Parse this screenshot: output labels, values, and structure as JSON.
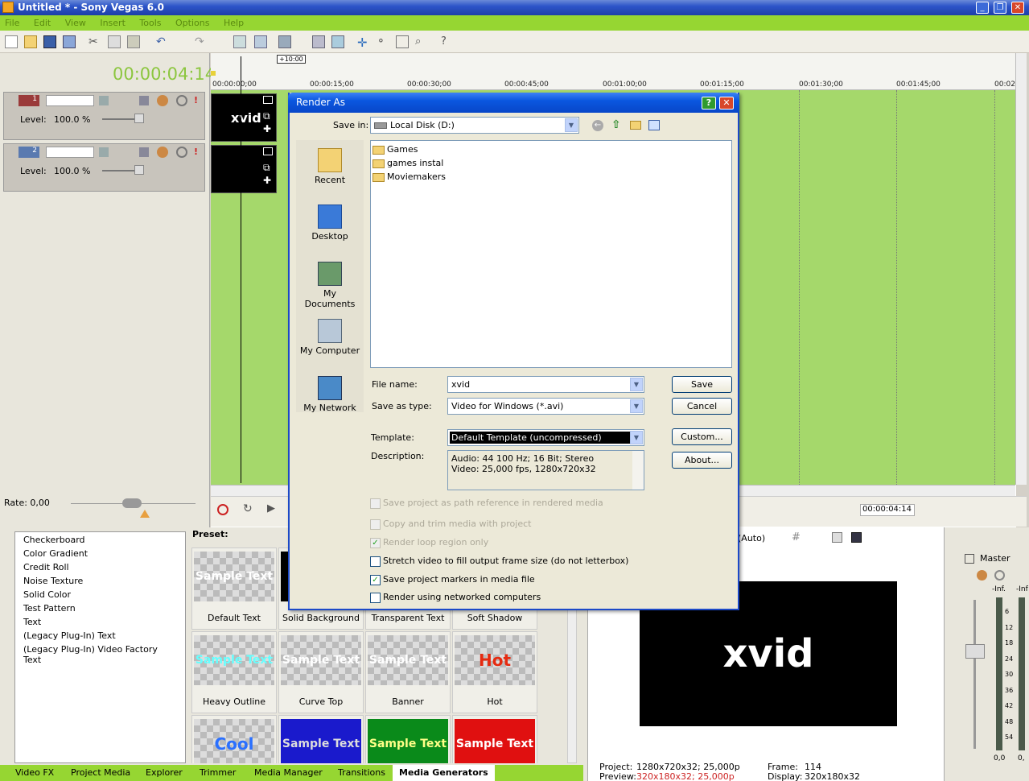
{
  "window": {
    "title": "Untitled * - Sony Vegas 6.0"
  },
  "menu": [
    "File",
    "Edit",
    "View",
    "Insert",
    "Tools",
    "Options",
    "Help"
  ],
  "timeline": {
    "timecode": "00:00:04:14",
    "offset_label": "+10:00",
    "ruler": [
      "00:00:00;00",
      "00:00:15;00",
      "00:00:30;00",
      "00:00:45;00",
      "00:01:00;00",
      "00:01:15;00",
      "00:01:30;00",
      "00:01:45;00",
      "00:02"
    ],
    "tracks": [
      {
        "number": "1",
        "level_label": "Level:",
        "level_value": "100.0 %",
        "clip": "xvid"
      },
      {
        "number": "2",
        "level_label": "Level:",
        "level_value": "100.0 %",
        "clip": ""
      }
    ],
    "rate": "Rate: 0,00",
    "cursor_time": "00:00:04:14"
  },
  "dialog": {
    "title": "Render As",
    "save_in_label": "Save in:",
    "save_in_value": "Local Disk (D:)",
    "places": [
      "Recent",
      "Desktop",
      "My Documents",
      "My Computer",
      "My Network"
    ],
    "files": [
      "Games",
      "games instal",
      "Moviemakers"
    ],
    "file_name_label": "File name:",
    "file_name_value": "xvid",
    "save_type_label": "Save as type:",
    "save_type_value": "Video for Windows (*.avi)",
    "template_label": "Template:",
    "template_value": "Default Template (uncompressed)",
    "description_label": "Description:",
    "description_line1": "Audio: 44 100 Hz; 16 Bit; Stereo",
    "description_line2": "Video: 25,000 fps, 1280x720x32",
    "buttons": {
      "save": "Save",
      "cancel": "Cancel",
      "custom": "Custom...",
      "about": "About..."
    },
    "options": [
      {
        "label": "Save project as path reference in rendered media",
        "checked": false,
        "enabled": false
      },
      {
        "label": "Copy and trim media with project",
        "checked": false,
        "enabled": false
      },
      {
        "label": "Render loop region only",
        "checked": true,
        "enabled": false
      },
      {
        "label": "Stretch video to fill output frame size (do not letterbox)",
        "checked": false,
        "enabled": true
      },
      {
        "label": "Save project markers in media file",
        "checked": true,
        "enabled": true
      },
      {
        "label": "Render using networked computers",
        "checked": false,
        "enabled": true
      }
    ]
  },
  "generators": {
    "list": [
      "Checkerboard",
      "Color Gradient",
      "Credit Roll",
      "Noise Texture",
      "Solid Color",
      "Test Pattern",
      "Text",
      "(Legacy Plug-In) Text",
      "(Legacy Plug-In) Video Factory Text"
    ],
    "preset_label": "Preset:",
    "presets": [
      {
        "name": "Default Text",
        "thumb": "Sample Text",
        "color": "#ffffff",
        "bg": ""
      },
      {
        "name": "Solid Background",
        "thumb": "",
        "color": "#ffffff",
        "bg": "#000000"
      },
      {
        "name": "Transparent Text",
        "thumb": "",
        "color": "#ffffff",
        "bg": ""
      },
      {
        "name": "Soft Shadow",
        "thumb": "",
        "color": "#ffffff",
        "bg": ""
      },
      {
        "name": "Heavy Outline",
        "thumb": "Sample Text",
        "color": "#6ff",
        "bg": ""
      },
      {
        "name": "Curve Top",
        "thumb": "Sample Text",
        "color": "#fff",
        "bg": ""
      },
      {
        "name": "Banner",
        "thumb": "Sample Text",
        "color": "#fff",
        "bg": ""
      },
      {
        "name": "Hot",
        "thumb": "Hot",
        "color": "#e62a10",
        "bg": ""
      },
      {
        "name": "",
        "thumb": "Cool",
        "color": "#2a70ff",
        "bg": ""
      },
      {
        "name": "",
        "thumb": "Sample Text",
        "color": "#ddd",
        "bg": "#1a1acc"
      },
      {
        "name": "",
        "thumb": "Sample Text",
        "color": "#ffff88",
        "bg": "#0a8a1a"
      },
      {
        "name": "",
        "thumb": "Sample Text",
        "color": "#fff",
        "bg": "#e01010"
      }
    ]
  },
  "tabs": [
    "Video FX",
    "Project Media",
    "Explorer",
    "Trimmer",
    "Media Manager",
    "Transitions",
    "Media Generators"
  ],
  "preview": {
    "quality": "(Auto)",
    "frame_text": "xvid",
    "project_label": "Project:",
    "project_value": "1280x720x32; 25,000p",
    "preview_label": "Preview:",
    "preview_value": "320x180x32; 25,000p",
    "frame_label": "Frame:",
    "frame_value": "114",
    "display_label": "Display:",
    "display_value": "320x180x32"
  },
  "master": {
    "label": "Master",
    "inf_left": "-Inf.",
    "inf_right": "-Inf",
    "scale": [
      "6",
      "12",
      "18",
      "24",
      "30",
      "36",
      "42",
      "48",
      "54"
    ],
    "zero_left": "0,0",
    "zero_right": "0,"
  }
}
